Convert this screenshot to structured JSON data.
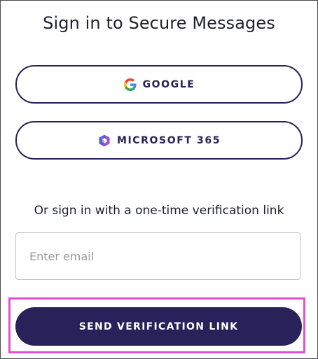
{
  "title": "Sign in to Secure Messages",
  "sso": {
    "google_label": "GOOGLE",
    "google_icon": "google-g-icon",
    "microsoft_label": "MICROSOFT 365",
    "microsoft_icon": "microsoft-365-icon"
  },
  "alt_signin_text": "Or sign in with a one-time verification link",
  "email": {
    "value": "",
    "placeholder": "Enter email"
  },
  "send_button_label": "SEND VERIFICATION LINK",
  "colors": {
    "primary": "#28215a",
    "highlight": "#e24fd1",
    "text": "#1f1f2e",
    "placeholder": "#9a9a9a"
  }
}
